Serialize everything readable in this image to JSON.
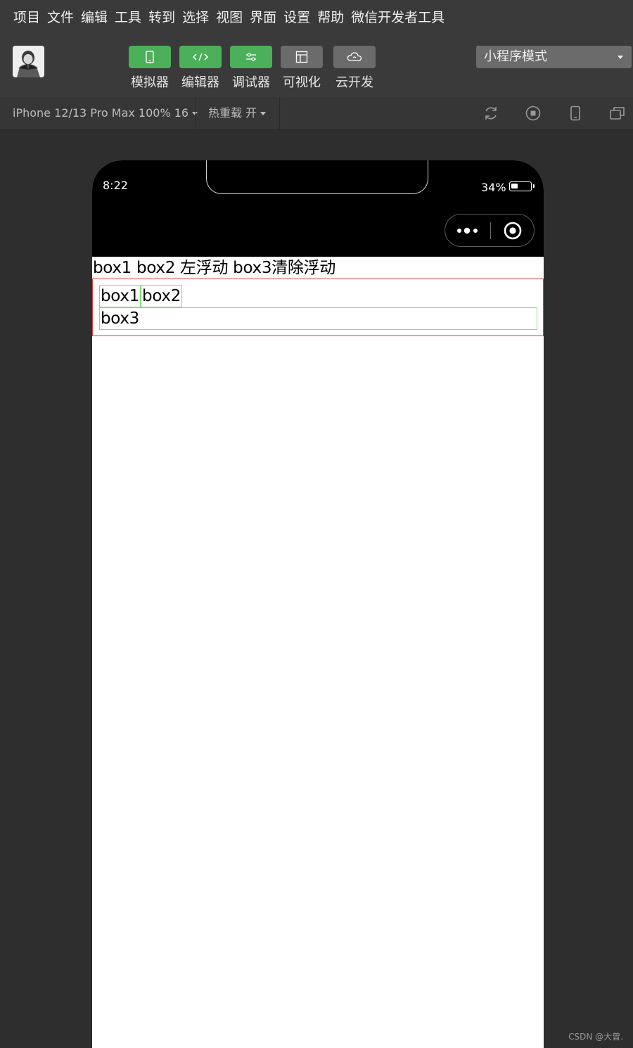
{
  "menu": [
    "项目",
    "文件",
    "编辑",
    "工具",
    "转到",
    "选择",
    "视图",
    "界面",
    "设置",
    "帮助",
    "微信开发者工具"
  ],
  "toolbar": {
    "buttons": [
      {
        "label": "模拟器",
        "icon": "phone-icon",
        "state": "active"
      },
      {
        "label": "编辑器",
        "icon": "code-icon",
        "state": "active"
      },
      {
        "label": "调试器",
        "icon": "sliders-icon",
        "state": "active"
      },
      {
        "label": "可视化",
        "icon": "layout-icon",
        "state": "inactive"
      },
      {
        "label": "云开发",
        "icon": "cloud-icon",
        "state": "inactive"
      }
    ],
    "mode": "小程序模式"
  },
  "device_bar": {
    "device": "iPhone 12/13 Pro Max 100% 16",
    "hot_reload": "热重载 开",
    "icons": [
      "refresh-icon",
      "stop-icon",
      "device-icon",
      "window-icon"
    ]
  },
  "phone": {
    "time": "8:22",
    "battery": "34%",
    "battery_level": 0.34,
    "capsule_icons": [
      "more-dots-icon",
      "close-target-icon"
    ]
  },
  "page": {
    "title": "box1 box2 左浮动 box3清除浮动",
    "box1": "box1",
    "box2": "box2",
    "box3": "box3"
  },
  "watermark": "CSDN @大曾."
}
